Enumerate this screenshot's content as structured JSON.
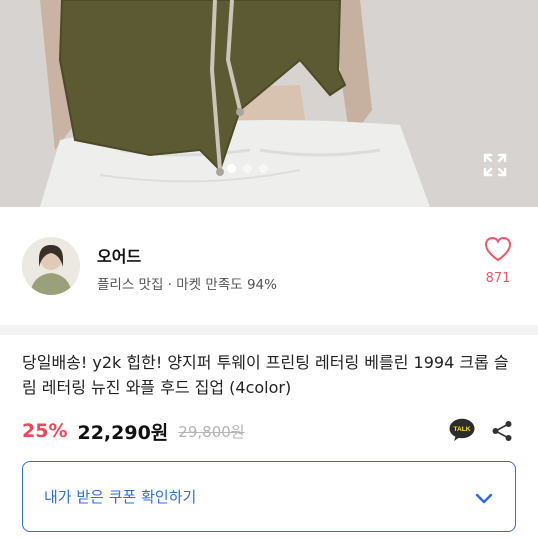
{
  "gallery": {
    "dot_count": 3,
    "active_index": 0,
    "expand_icon": "expand-icon"
  },
  "seller": {
    "name": "오어드",
    "meta": "플리스 맛집 · 마켓 만족도 94%",
    "likes": "871"
  },
  "product": {
    "title": "당일배송! y2k 힙한! 양지퍼 투웨이 프린팅 레터링 베를린 1994 크롭 슬림 레터링 뉴진 와플 후드 집업 (4color)",
    "discount": "25%",
    "price": "22,290원",
    "original_price": "29,800원",
    "talk_label": "TALK"
  },
  "coupon": {
    "label": "내가 받은 쿠폰 확인하기"
  },
  "colors": {
    "accent_blue": "#2f6fe0",
    "discount_red": "#f0465a",
    "heart_pink": "#f0586a"
  }
}
